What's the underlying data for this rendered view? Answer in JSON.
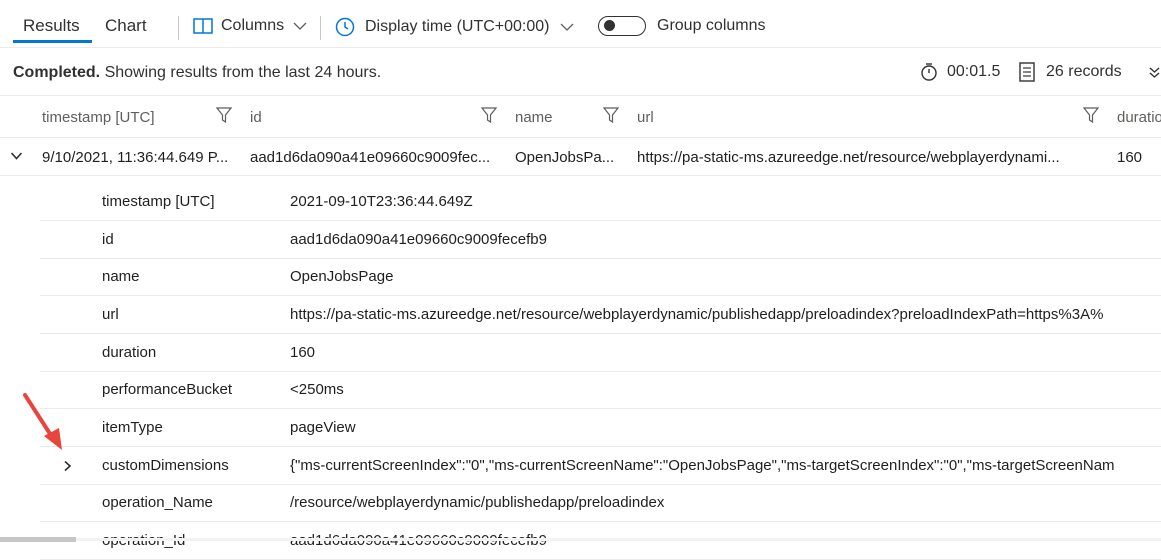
{
  "toolbar": {
    "tabs": [
      "Results",
      "Chart"
    ],
    "columns_label": "Columns",
    "display_time_label": "Display time (UTC+00:00)",
    "group_columns_label": "Group columns"
  },
  "status": {
    "completed": "Completed.",
    "message": "Showing results from the last 24 hours.",
    "duration": "00:01.5",
    "records": "26 records"
  },
  "columns": [
    "timestamp [UTC]",
    "id",
    "name",
    "url",
    "duratio"
  ],
  "row": {
    "timestamp": "9/10/2021, 11:36:44.649 P...",
    "id": "aad1d6da090a41e09660c9009fec...",
    "name": "OpenJobsPa...",
    "url": "https://pa-static-ms.azureedge.net/resource/webplayerdynami...",
    "duration": "160"
  },
  "details": [
    {
      "key": "timestamp [UTC]",
      "value": "2021-09-10T23:36:44.649Z"
    },
    {
      "key": "id",
      "value": "aad1d6da090a41e09660c9009fecefb9"
    },
    {
      "key": "name",
      "value": "OpenJobsPage"
    },
    {
      "key": "url",
      "value": "https://pa-static-ms.azureedge.net/resource/webplayerdynamic/publishedapp/preloadindex?preloadIndexPath=https%3A%"
    },
    {
      "key": "duration",
      "value": "160"
    },
    {
      "key": "performanceBucket",
      "value": "<250ms"
    },
    {
      "key": "itemType",
      "value": "pageView"
    },
    {
      "key": "customDimensions",
      "value": "{\"ms-currentScreenIndex\":\"0\",\"ms-currentScreenName\":\"OpenJobsPage\",\"ms-targetScreenIndex\":\"0\",\"ms-targetScreenNam"
    },
    {
      "key": "operation_Name",
      "value": "/resource/webplayerdynamic/publishedapp/preloadindex"
    },
    {
      "key": "operation_Id",
      "value": "aad1d6da090a41e09660c9009fecefb9"
    }
  ],
  "colors": {
    "accent": "#0078d4",
    "arrow": "#e8453c"
  }
}
